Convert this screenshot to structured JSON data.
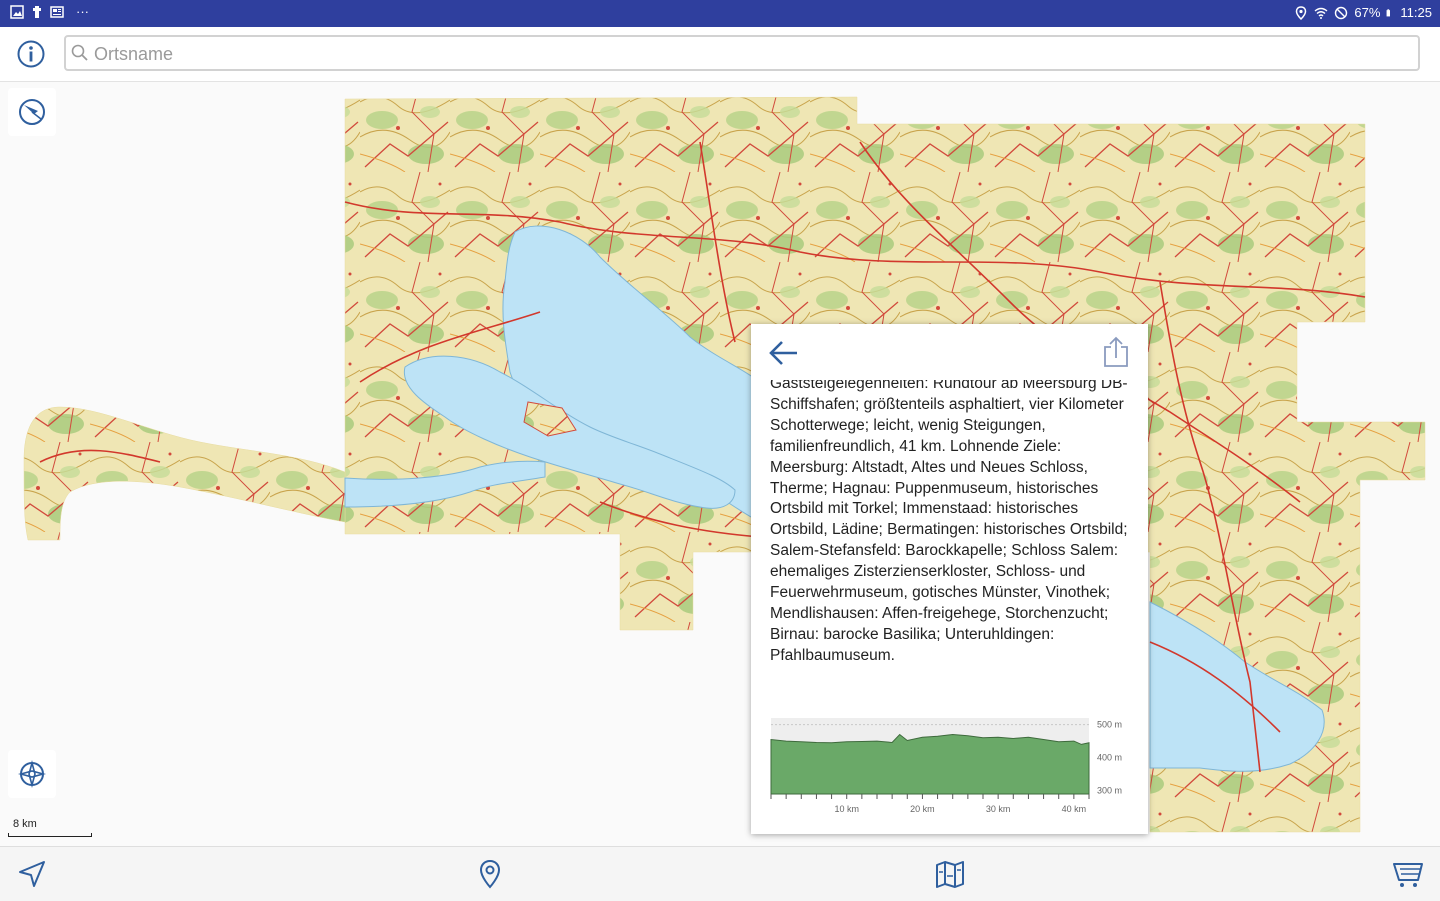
{
  "status_bar": {
    "battery": "67%",
    "time": "11:25",
    "overflow": "···"
  },
  "search": {
    "placeholder": "Ortsname",
    "value": ""
  },
  "map": {
    "scale_label": "8 km"
  },
  "info_panel": {
    "description": "Gaststeigelegenheiten: Rundtour ab Meersburg DB-Schiffshafen; größtenteils asphaltiert, vier Kilometer Schotterwege; leicht, wenig Steigungen, familienfreundlich, 41 km. Lohnende Ziele: Meersburg: Altstadt, Altes und Neues Schloss, Therme; Hagnau: Puppenmuseum, historisches Ortsbild mit Torkel; Immenstaad: historisches Ortsbild, Lädine; Bermatingen: historisches Ortsbild; Salem-Stefansfeld: Barockkapelle; Schloss Salem: ehemaliges Zisterzienserkloster, Schloss- und Feuerwehrmuseum, gotisches Münster, Vinothek; Mendlishausen: Affen-freigehege, Storchenzucht; Birnau: barocke Basilika; Unteruhldingen: Pfahlbaumuseum.",
    "elevation_profile": {
      "y_labels": [
        "500 m",
        "400 m",
        "300 m"
      ],
      "x_labels": [
        "10 km",
        "20 km",
        "30 km",
        "40 km"
      ],
      "x_max": 42,
      "y_range": [
        290,
        520
      ],
      "profile": [
        [
          0,
          455
        ],
        [
          2,
          450
        ],
        [
          4,
          448
        ],
        [
          6,
          446
        ],
        [
          8,
          445
        ],
        [
          10,
          448
        ],
        [
          12,
          449
        ],
        [
          14,
          450
        ],
        [
          16,
          446
        ],
        [
          17,
          470
        ],
        [
          18,
          452
        ],
        [
          20,
          462
        ],
        [
          22,
          465
        ],
        [
          24,
          470
        ],
        [
          26,
          466
        ],
        [
          28,
          460
        ],
        [
          30,
          462
        ],
        [
          32,
          458
        ],
        [
          34,
          462
        ],
        [
          36,
          455
        ],
        [
          38,
          448
        ],
        [
          40,
          450
        ],
        [
          41,
          440
        ],
        [
          42,
          445
        ]
      ],
      "fill_color": "#6aa968"
    }
  },
  "colors": {
    "status_bar": "#2f3f9e",
    "accent": "#2f5f9e",
    "water": "#bde3f6"
  }
}
